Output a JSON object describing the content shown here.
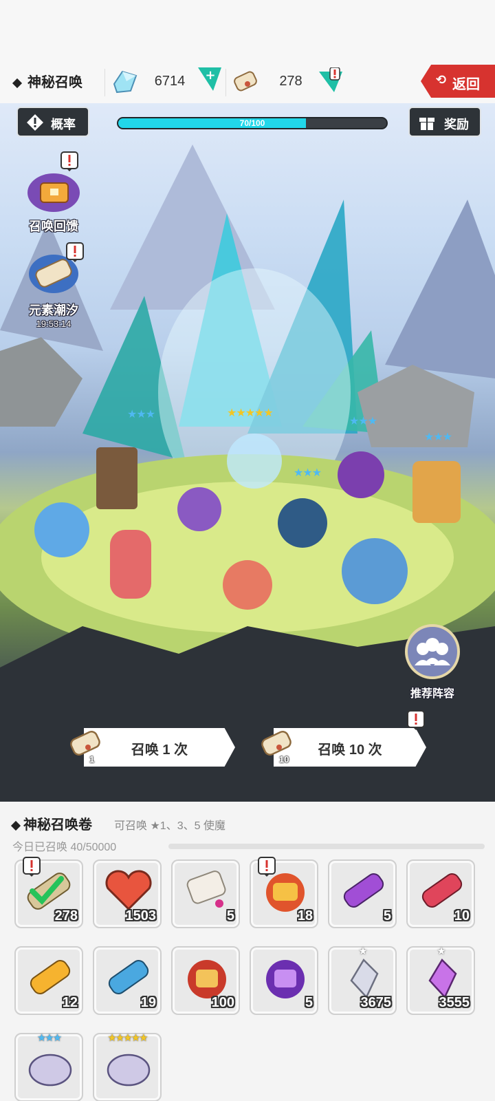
{
  "header": {
    "title": "神秘召唤",
    "gems": {
      "icon": "gem-icon",
      "value": "6714"
    },
    "scrolls": {
      "icon": "scroll-icon",
      "value": "278"
    },
    "back_label": "返回"
  },
  "scene": {
    "rate_label": "概率",
    "reward_label": "奖励",
    "progress": {
      "text": "70/100",
      "value": 70,
      "max": 100
    },
    "events": [
      {
        "label": "召唤回馈"
      },
      {
        "label": "元素潮汐",
        "timer": "19:53:14"
      }
    ],
    "recommend_label": "推荐阵容",
    "summon_once": {
      "label": "召唤 1 次",
      "cost": "1"
    },
    "summon_ten": {
      "label": "召唤 10 次",
      "cost": "10"
    }
  },
  "inventory": {
    "title": "神秘召唤卷",
    "subtitle": "可召唤 ★1、3、5 使魔",
    "daily": "今日已召唤 40/50000",
    "items": [
      {
        "name": "scroll-selected",
        "count": "278",
        "alert": true
      },
      {
        "name": "heart",
        "count": "1503"
      },
      {
        "name": "parchment",
        "count": "5"
      },
      {
        "name": "fire-orb",
        "count": "18",
        "alert": true
      },
      {
        "name": "purple-scroll",
        "count": "5"
      },
      {
        "name": "red-scroll",
        "count": "10"
      },
      {
        "name": "gold-scroll",
        "count": "12"
      },
      {
        "name": "blue-scroll",
        "count": "19"
      },
      {
        "name": "red-orb",
        "count": "100"
      },
      {
        "name": "purple-orb",
        "count": "5"
      },
      {
        "name": "silver-crystal",
        "count": "3675",
        "stars": "★"
      },
      {
        "name": "purple-crystal",
        "count": "3555",
        "stars": "★"
      },
      {
        "name": "three-star-shard",
        "count": "",
        "stars": "★★★"
      },
      {
        "name": "five-star-shard",
        "count": "",
        "stars": "★★★★★"
      }
    ]
  },
  "colors": {
    "accent": "#21d7ea",
    "back": "#d7332f",
    "flag": "#1fbfa6"
  }
}
